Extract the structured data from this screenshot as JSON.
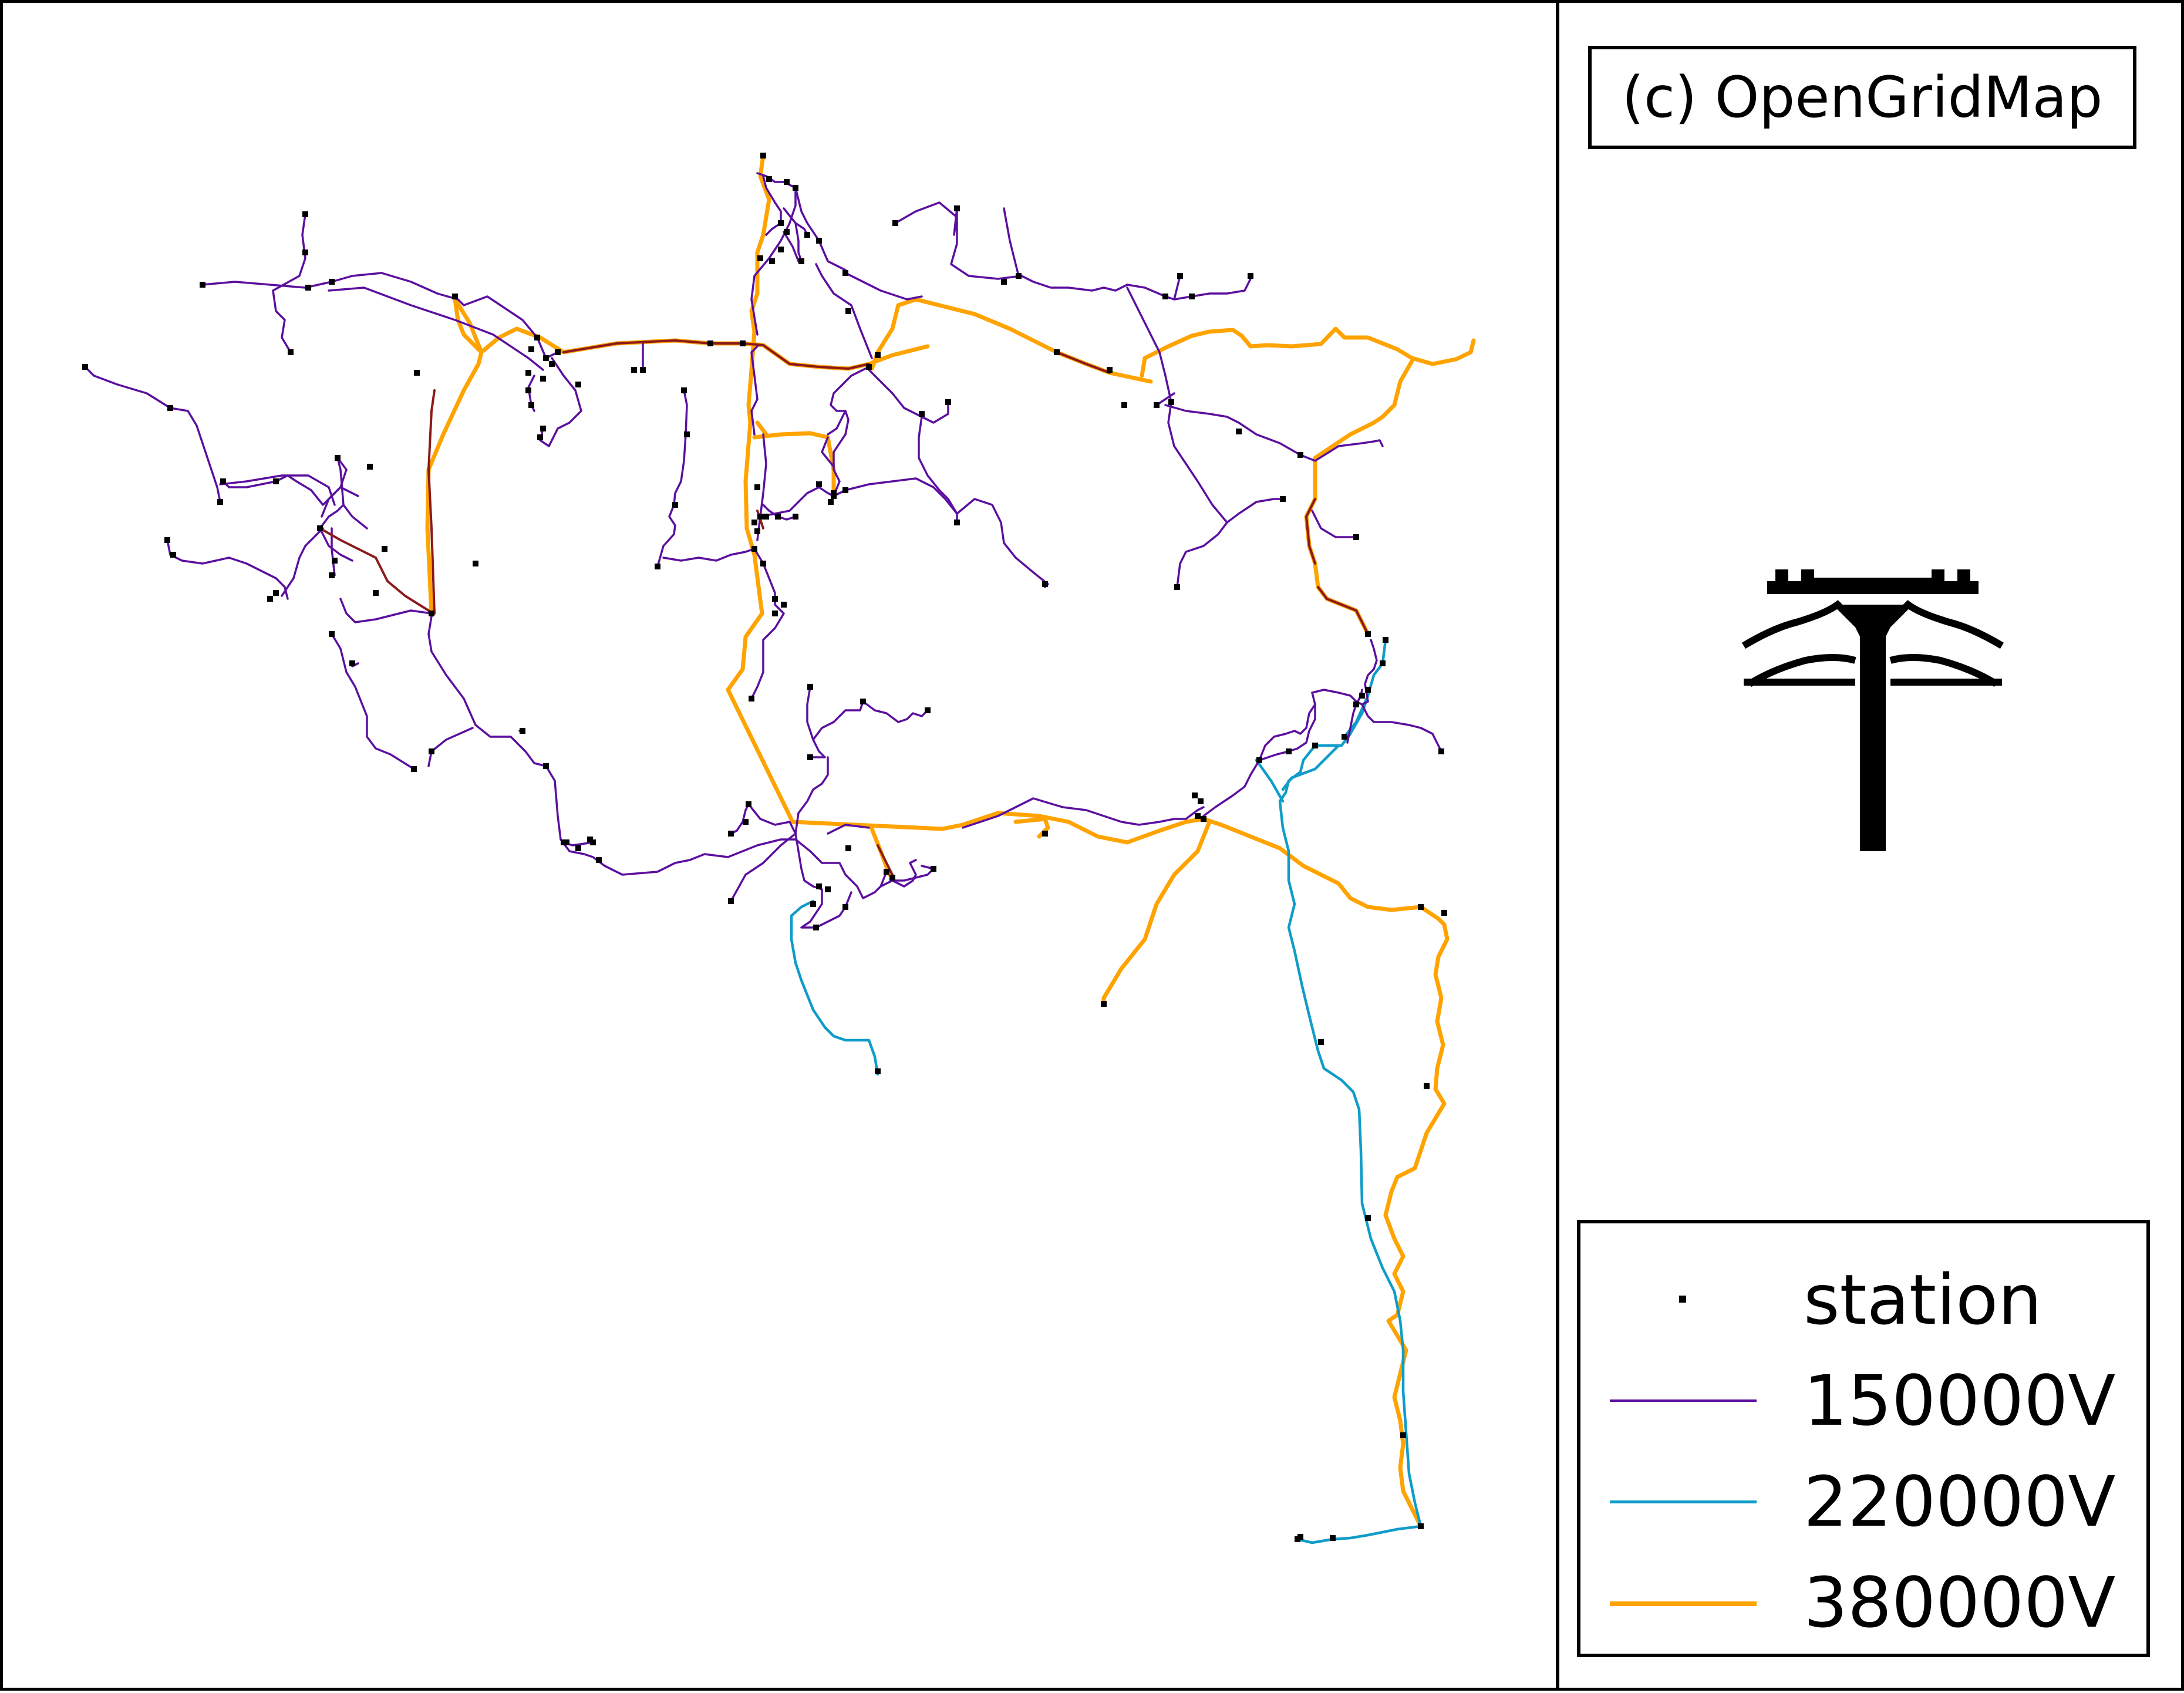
{
  "copyright": "(c) OpenGridMap",
  "legend": {
    "items": [
      {
        "label": "station",
        "kind": "station",
        "color": "#000000"
      },
      {
        "label": "150000V",
        "kind": "line",
        "color": "#5b0f9e"
      },
      {
        "label": "220000V",
        "kind": "line",
        "color": "#0f9cc9"
      },
      {
        "label": "380000V",
        "kind": "line",
        "color": "#ffa300"
      }
    ]
  },
  "icon": "power-pylon-icon",
  "colors": {
    "line_150kV": "#5b0f9e",
    "line_220kV": "#0f9cc9",
    "line_380kV": "#ffa300",
    "overlap": "#8b1a1a",
    "station": "#000000"
  }
}
